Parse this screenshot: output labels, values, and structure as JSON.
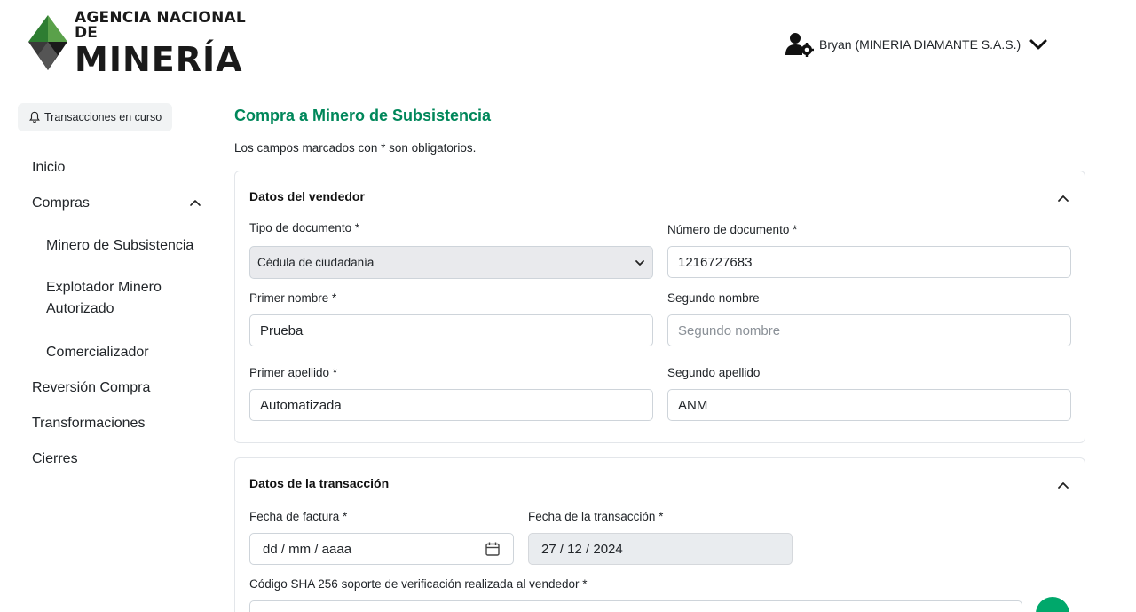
{
  "header": {
    "logo_line1": "AGENCIA NACIONAL DE",
    "logo_line2": "MINERÍA",
    "user_name": "Bryan (MINERIA DIAMANTE S.A.S.)"
  },
  "sidebar": {
    "transactions_button": "Transacciones en curso",
    "items": [
      {
        "label": "Inicio"
      },
      {
        "label": "Compras"
      },
      {
        "label": "Minero de Subsistencia"
      },
      {
        "label": "Explotador Minero Autorizado"
      },
      {
        "label": "Comercializador"
      },
      {
        "label": "Reversión Compra"
      },
      {
        "label": "Transformaciones"
      },
      {
        "label": "Cierres"
      }
    ]
  },
  "main": {
    "title": "Compra a Minero de Subsistencia",
    "required_note": "Los campos marcados con * son obligatorios.",
    "vendor": {
      "title": "Datos del vendedor",
      "doc_type_label": "Tipo de documento *",
      "doc_type_value": "Cédula de ciudadanía",
      "doc_number_label": "Número de documento *",
      "doc_number_value": "1216727683",
      "first_name_label": "Primer nombre *",
      "first_name_value": "Prueba",
      "second_name_label": "Segundo nombre",
      "second_name_placeholder": "Segundo nombre",
      "first_surname_label": "Primer apellido *",
      "first_surname_value": "Automatizada",
      "second_surname_label": "Segundo apellido",
      "second_surname_value": "ANM"
    },
    "transaction": {
      "title": "Datos de la transacción",
      "invoice_date_label": "Fecha de factura *",
      "invoice_date_value": "dd / mm / aaaa",
      "tx_date_label": "Fecha de la transacción *",
      "tx_date_value": "27 / 12 / 2024",
      "sha_label": "Código SHA 256 soporte de verificación realizada al vendedor *"
    }
  },
  "colors": {
    "accent_green": "#00875a",
    "fab_green": "#00a86b"
  }
}
